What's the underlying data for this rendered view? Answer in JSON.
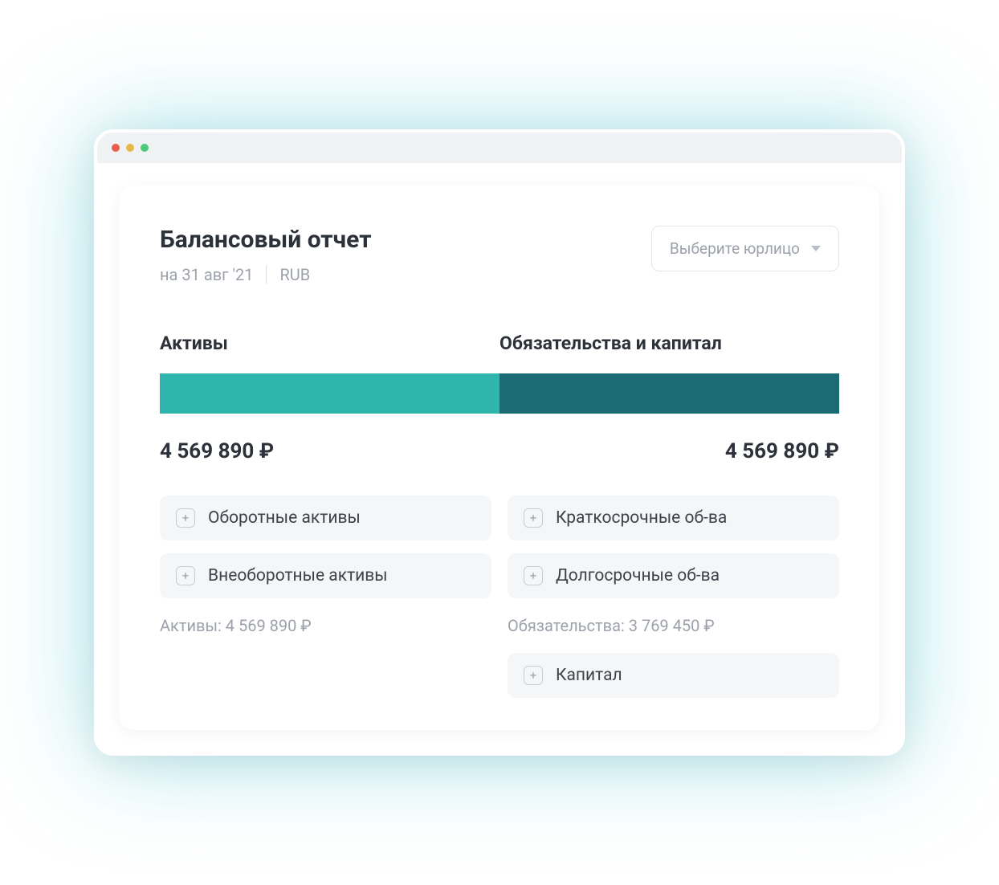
{
  "header": {
    "title": "Балансовый отчет",
    "date": "на 31 авг '21",
    "currency": "RUB"
  },
  "dropdown": {
    "label": "Выберите юрлицо"
  },
  "columns": {
    "left_label": "Активы",
    "right_label": "Обязательства и капитал"
  },
  "totals": {
    "left": "4 569 890 ₽",
    "right": "4 569 890 ₽"
  },
  "assets": {
    "items": [
      {
        "label": "Оборотные активы"
      },
      {
        "label": "Внеоборотные активы"
      }
    ],
    "subtotal": "Активы: 4 569 890 ₽"
  },
  "liabilities": {
    "items": [
      {
        "label": "Краткосрочные об-ва"
      },
      {
        "label": "Долгосрочные об-ва"
      }
    ],
    "subtotal": "Обязательства: 3 769 450 ₽",
    "capital": {
      "label": "Капитал"
    }
  },
  "colors": {
    "bar_left": "#2fb5ac",
    "bar_right": "#1a6b74"
  }
}
